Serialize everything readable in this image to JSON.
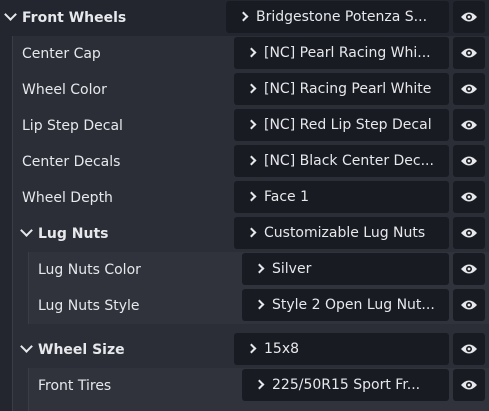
{
  "rows": [
    {
      "label": "Front Wheels",
      "value": "Bridgestone Potenza S...",
      "section": true
    },
    {
      "label": "Center Cap",
      "value": "[NC] Pearl Racing Whi..."
    },
    {
      "label": "Wheel Color",
      "value": "[NC] Racing Pearl White"
    },
    {
      "label": "Lip Step Decal",
      "value": "[NC] Red Lip Step Decal"
    },
    {
      "label": "Center Decals",
      "value": "[NC] Black Center Dec..."
    },
    {
      "label": "Wheel Depth",
      "value": "Face 1"
    },
    {
      "label": "Lug Nuts",
      "value": "Customizable Lug Nuts",
      "section": true
    },
    {
      "label": "Lug Nuts Color",
      "value": "Silver"
    },
    {
      "label": "Lug Nuts Style",
      "value": "Style 2 Open Lug Nut..."
    },
    {
      "label": "Wheel Size",
      "value": "15x8",
      "section": true
    },
    {
      "label": "Front Tires",
      "value": "225/50R15 Sport Fr..."
    }
  ],
  "icons": {
    "section_toggle": "chevron-down-icon",
    "value_expand": "chevron-right-icon",
    "visibility": "eye-icon"
  },
  "colors": {
    "background": "#23262e",
    "field": "#191b22",
    "text": "#e6e8ec"
  }
}
